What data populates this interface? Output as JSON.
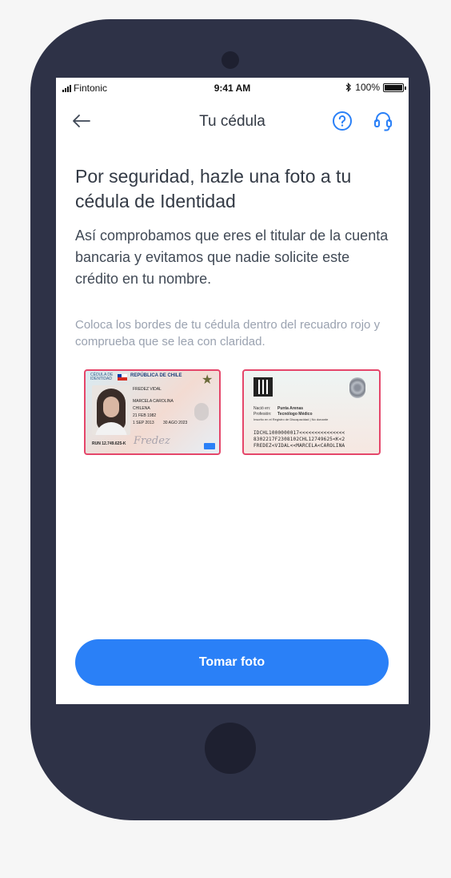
{
  "status_bar": {
    "carrier": "Fintonic",
    "time": "9:41 AM",
    "battery": "100%",
    "battery_level": 1.0
  },
  "nav": {
    "title": "Tu cédula",
    "back_icon": "arrow-left-icon",
    "help_icon": "question-circle-icon",
    "support_icon": "headset-icon"
  },
  "content": {
    "heading": "Por seguridad, hazle una foto a tu cédula de Identidad",
    "description": "Así comprobamos que eres el titular de la cuenta bancaria y evitamos que nadie solicite este crédito en tu nombre.",
    "instruction": "Coloca los bordes de tu cédula dentro del recuadro rojo y comprueba que se lea con claridad."
  },
  "id_front": {
    "header_left": "CÉDULA DE IDENTIDAD",
    "country": "REPÚBLICA DE CHILE",
    "surnames": "FREDEZ VIDAL",
    "names": "MARCELA CAROLINA",
    "nationality": "CHILENA",
    "birth_date": "21 FEB 1982",
    "issue_date": "1 SEP 2013",
    "expiry_date": "30 AGO 2023",
    "run": "RUN 12.749.625-K"
  },
  "id_back": {
    "born_in_label": "Nació en:",
    "born_in": "Punta Arenas",
    "profession_label": "Profesión:",
    "profession": "Tecnólogo Médico",
    "registry": "Inscrito en el Registro de Discapacidad | No donante",
    "mrz": [
      "IDCHL1000000017<<<<<<<<<<<<<<<",
      "8302217F2308102CHL12749625<K<2",
      "FREDEZ<VIDAL<<MARCELA<CAROLINA"
    ]
  },
  "colors": {
    "accent": "#2a80f7",
    "frame": "#e5466a",
    "device": "#2e3247"
  },
  "cta": {
    "label": "Tomar foto"
  }
}
